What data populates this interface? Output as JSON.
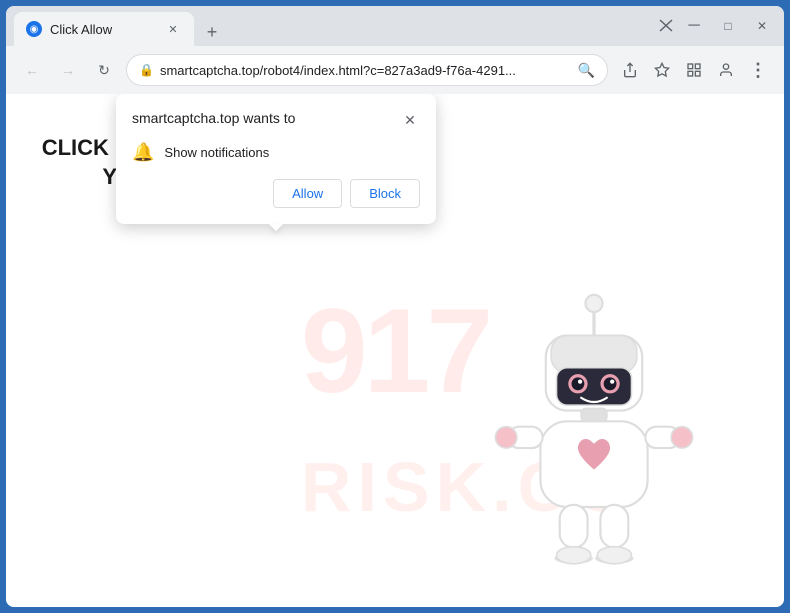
{
  "window": {
    "title": "Click Allow",
    "new_tab_label": "+",
    "close_label": "✕",
    "minimize_label": "─",
    "maximize_label": "□"
  },
  "address_bar": {
    "url": "smartcaptcha.top/robot4/index.html?c=827a3ad9-f76a-4291...",
    "lock_icon": "🔒"
  },
  "toolbar": {
    "back_label": "←",
    "forward_label": "→",
    "refresh_label": "↻",
    "search_icon": "🔍",
    "share_icon": "⬆",
    "star_icon": "☆",
    "extensions_icon": "□",
    "profile_icon": "👤",
    "menu_icon": "⋮"
  },
  "page": {
    "main_text": "CLICK «ALLOW» TO CONFIRM THAT YOU ARE NOT A ROBOT!"
  },
  "popup": {
    "title": "smartcaptcha.top wants to",
    "close_label": "✕",
    "notification_label": "Show notifications",
    "allow_label": "Allow",
    "block_label": "Block"
  },
  "watermark": {
    "line1": "917",
    "line2": "RISK.CO"
  }
}
